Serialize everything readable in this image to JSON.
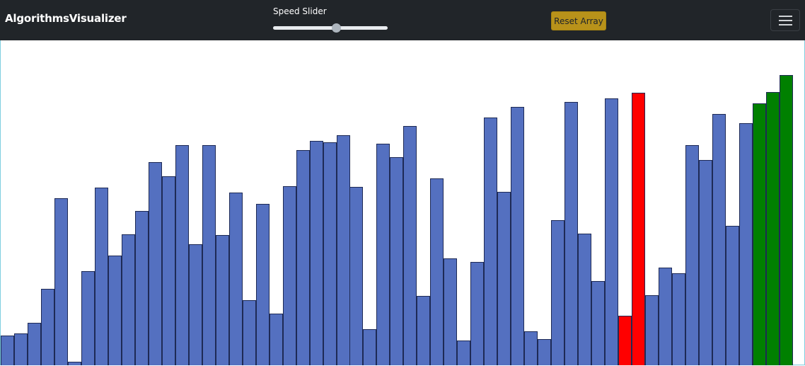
{
  "navbar": {
    "brand": "AlgorithmsVisualizer",
    "speed_label": "Speed Slider",
    "speed_value": 0.55,
    "reset_label": "Reset Array",
    "menu_icon": "hamburger-menu-icon"
  },
  "colors": {
    "navbar_bg": "#212529",
    "default_bar": "#5470c0",
    "comparing_bar": "#ff0000",
    "sorted_bar": "#008000",
    "reset_button": "#b8921a"
  },
  "array": {
    "values": [
      42,
      45,
      60,
      108,
      236,
      5,
      133,
      251,
      155,
      185,
      218,
      287,
      267,
      311,
      171,
      311,
      184,
      244,
      92,
      228,
      73,
      253,
      304,
      317,
      315,
      325,
      252,
      51,
      313,
      294,
      338,
      98,
      264,
      151,
      35,
      146,
      350,
      245,
      365,
      48,
      37,
      205,
      372,
      186,
      119,
      377,
      70,
      385,
      99,
      138,
      130,
      311,
      290,
      355,
      197,
      342,
      370,
      386,
      410
    ],
    "states": [
      "default",
      "default",
      "default",
      "default",
      "default",
      "default",
      "default",
      "default",
      "default",
      "default",
      "default",
      "default",
      "default",
      "default",
      "default",
      "default",
      "default",
      "default",
      "default",
      "default",
      "default",
      "default",
      "default",
      "default",
      "default",
      "default",
      "default",
      "default",
      "default",
      "default",
      "default",
      "default",
      "default",
      "default",
      "default",
      "default",
      "default",
      "default",
      "default",
      "default",
      "default",
      "default",
      "default",
      "default",
      "default",
      "default",
      "comparing",
      "comparing",
      "default",
      "default",
      "default",
      "default",
      "default",
      "default",
      "default",
      "default",
      "sorted",
      "sorted",
      "sorted"
    ]
  }
}
